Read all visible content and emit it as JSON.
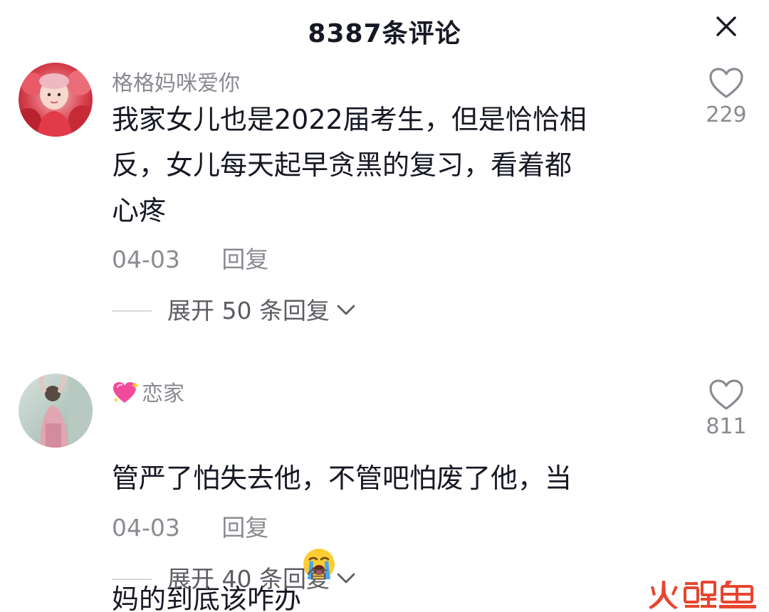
{
  "header": {
    "title": "8387条评论"
  },
  "comments": [
    {
      "username": "格格妈咪爱你",
      "text": "我家女儿也是2022届考生，但是恰恰相\n反，女儿每天起早贪黑的复习，看着都\n心疼",
      "date": "04-03",
      "reply_label": "回复",
      "expand_label": "展开 50 条回复",
      "likes": "229"
    },
    {
      "username": "恋家",
      "text": "管严了怕失去他，不管吧怕废了他，当\n妈的到底该咋办",
      "date": "04-03",
      "reply_label": "回复",
      "expand_label": "展开 40 条回复",
      "likes": "811"
    }
  ],
  "icons": {
    "close": "close-icon",
    "like": "heart-outline-icon",
    "expand": "chevron-down-icon",
    "username_badge": "sparkling-heart-emoji",
    "emoji_in_comment": "loudly-crying-face-emoji"
  },
  "watermark": {
    "text": "火鲤鱼",
    "accent_color": "#e8452f"
  },
  "colors": {
    "text_primary": "#161823",
    "text_secondary": "#8a8b91",
    "background": "#ffffff"
  }
}
